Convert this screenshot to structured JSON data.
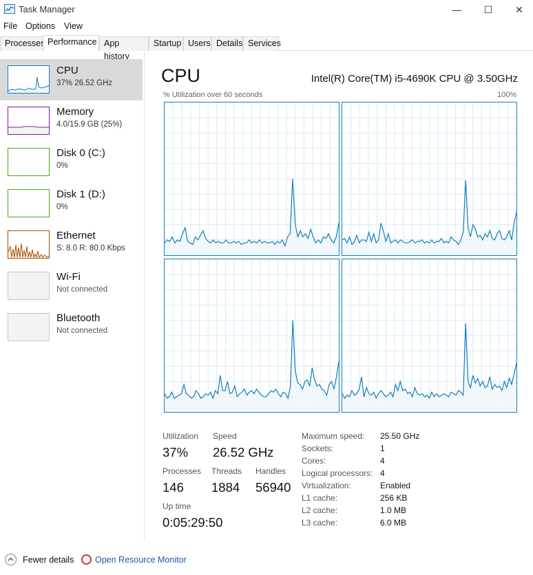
{
  "window": {
    "title": "Task Manager",
    "minimize": "—",
    "maximize": "☐",
    "close": "✕"
  },
  "menu": [
    "File",
    "Options",
    "View"
  ],
  "tabs": [
    "Processes",
    "Performance",
    "App history",
    "Startup",
    "Users",
    "Details",
    "Services"
  ],
  "active_tab": "Performance",
  "sidebar": {
    "items": [
      {
        "title": "CPU",
        "subtitle": "37% 26.52 GHz",
        "color": "#117dbb",
        "selected": true
      },
      {
        "title": "Memory",
        "subtitle": "4.0/15.9 GB (25%)",
        "color": "#8b12ae",
        "selected": false
      },
      {
        "title": "Disk 0 (C:)",
        "subtitle": "0%",
        "color": "#4da60c",
        "selected": false
      },
      {
        "title": "Disk 1 (D:)",
        "subtitle": "0%",
        "color": "#4da60c",
        "selected": false
      },
      {
        "title": "Ethernet",
        "subtitle": "S: 8.0 R: 80.0 Kbps",
        "color": "#a74f01",
        "selected": false
      },
      {
        "title": "Wi-Fi",
        "subtitle": "Not connected",
        "color": "#aaaaaa",
        "selected": false
      },
      {
        "title": "Bluetooth",
        "subtitle": "Not connected",
        "color": "#aaaaaa",
        "selected": false
      }
    ]
  },
  "main": {
    "title": "CPU",
    "model": "Intel(R) Core(TM) i5-4690K CPU @ 3.50GHz",
    "graph_label": "% Utilization over 60 seconds",
    "graph_max": "100%",
    "graph_color": "#117dbb",
    "graph_fill": "#f1f6fa",
    "grid_color": "#d9eaf4"
  },
  "stats": {
    "utilization_label": "Utilization",
    "utilization": "37%",
    "speed_label": "Speed",
    "speed": "26.52 GHz",
    "processes_label": "Processes",
    "processes": "146",
    "threads_label": "Threads",
    "threads": "1884",
    "handles_label": "Handles",
    "handles": "56940",
    "uptime_label": "Up time",
    "uptime": "0:05:29:50"
  },
  "specs": [
    {
      "label": "Maximum speed:",
      "value": "25.50 GHz"
    },
    {
      "label": "Sockets:",
      "value": "1"
    },
    {
      "label": "Cores:",
      "value": "4"
    },
    {
      "label": "Logical processors:",
      "value": "4"
    },
    {
      "label": "Virtualization:",
      "value": "Enabled"
    },
    {
      "label": "L1 cache:",
      "value": "256 KB"
    },
    {
      "label": "L2 cache:",
      "value": "1.0 MB"
    },
    {
      "label": "L3 cache:",
      "value": "6.0 MB"
    }
  ],
  "footer": {
    "fewer_details": "Fewer details",
    "resource_monitor": "Open Resource Monitor"
  },
  "chart_data": [
    {
      "type": "area",
      "title": "",
      "ylim": [
        0,
        100
      ],
      "values": [
        8,
        10,
        9,
        12,
        8,
        10,
        9,
        14,
        18,
        9,
        8,
        7,
        12,
        10,
        13,
        16,
        11,
        9,
        8,
        10,
        8,
        9,
        8,
        8,
        10,
        8,
        8,
        9,
        8,
        9,
        7,
        8,
        8,
        10,
        8,
        9,
        8,
        10,
        8,
        9,
        8,
        8,
        9,
        7,
        9,
        8,
        10,
        6,
        12,
        14,
        50,
        20,
        12,
        16,
        12,
        14,
        11,
        17,
        12,
        8,
        10,
        8,
        12,
        11,
        14,
        10,
        8,
        12,
        21
      ]
    },
    {
      "type": "area",
      "title": "",
      "ylim": [
        0,
        100
      ],
      "values": [
        10,
        11,
        8,
        12,
        7,
        9,
        13,
        8,
        10,
        10,
        9,
        15,
        9,
        14,
        8,
        10,
        21,
        16,
        9,
        14,
        8,
        9,
        10,
        8,
        10,
        9,
        8,
        8,
        9,
        10,
        8,
        9,
        9,
        10,
        8,
        9,
        8,
        10,
        8,
        9,
        9,
        11,
        8,
        9,
        8,
        12,
        10,
        9,
        7,
        10,
        15,
        49,
        18,
        12,
        20,
        17,
        12,
        13,
        10,
        14,
        12,
        16,
        11,
        10,
        14,
        16,
        11,
        10,
        12,
        16,
        10,
        21,
        28
      ]
    },
    {
      "type": "area",
      "title": "",
      "ylim": [
        0,
        100
      ],
      "values": [
        12,
        9,
        10,
        13,
        9,
        10,
        11,
        12,
        18,
        12,
        11,
        9,
        10,
        14,
        12,
        9,
        10,
        12,
        11,
        13,
        9,
        14,
        12,
        24,
        14,
        14,
        20,
        12,
        13,
        17,
        10,
        12,
        13,
        15,
        11,
        13,
        14,
        12,
        15,
        13,
        11,
        10,
        10,
        12,
        14,
        13,
        15,
        12,
        10,
        13,
        12,
        9,
        17,
        60,
        27,
        19,
        18,
        15,
        20,
        21,
        17,
        29,
        21,
        17,
        18,
        15,
        14,
        11,
        18,
        20,
        15,
        23,
        33
      ]
    },
    {
      "type": "area",
      "title": "",
      "ylim": [
        0,
        100
      ],
      "values": [
        12,
        9,
        11,
        10,
        14,
        11,
        12,
        15,
        23,
        10,
        16,
        12,
        11,
        13,
        9,
        12,
        14,
        12,
        10,
        11,
        13,
        10,
        18,
        14,
        20,
        14,
        15,
        12,
        13,
        10,
        16,
        12,
        11,
        12,
        10,
        11,
        9,
        13,
        10,
        12,
        10,
        11,
        12,
        11,
        10,
        13,
        12,
        11,
        14,
        13,
        11,
        58,
        20,
        16,
        24,
        19,
        22,
        17,
        20,
        16,
        17,
        23,
        15,
        18,
        16,
        17,
        14,
        20,
        16,
        22,
        18,
        25,
        32
      ]
    }
  ]
}
